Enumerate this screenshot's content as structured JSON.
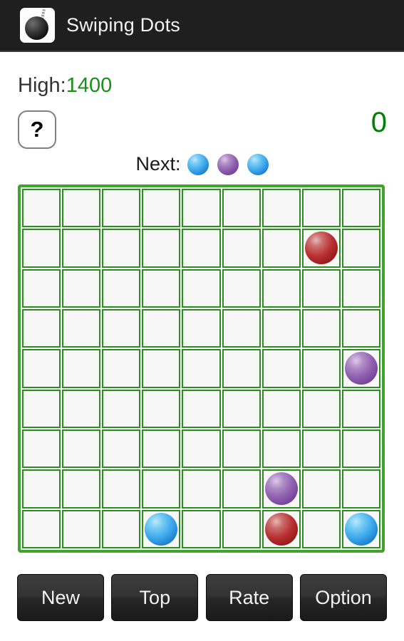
{
  "titlebar": {
    "app_name": "Swiping Dots",
    "icon": "wrecking-ball-icon"
  },
  "stats": {
    "high_label": "High:",
    "high_value": "1400",
    "score": "0",
    "help_label": "?"
  },
  "next": {
    "label": "Next:",
    "balls": [
      "blue",
      "purple",
      "blue"
    ]
  },
  "board": {
    "rows": 9,
    "cols": 9,
    "balls": [
      {
        "row": 1,
        "col": 7,
        "color": "red"
      },
      {
        "row": 4,
        "col": 8,
        "color": "purple"
      },
      {
        "row": 7,
        "col": 6,
        "color": "purple"
      },
      {
        "row": 8,
        "col": 3,
        "color": "blue"
      },
      {
        "row": 8,
        "col": 6,
        "color": "red"
      },
      {
        "row": 8,
        "col": 8,
        "color": "blue"
      }
    ]
  },
  "buttons": [
    {
      "label": "New",
      "name": "new-game-button"
    },
    {
      "label": "Top",
      "name": "top-scores-button"
    },
    {
      "label": "Rate",
      "name": "rate-button"
    },
    {
      "label": "Option",
      "name": "option-button"
    }
  ],
  "colors": {
    "board_border": "#3ea52b",
    "cell_border": "#2e8b22",
    "score_green": "#008000",
    "high_green": "#1a8f1a",
    "titlebar_bg": "#1f1f1f",
    "button_bg": "#262626",
    "ball_blue": "#3fa9ec",
    "ball_purple": "#8e5fae",
    "ball_red": "#b93030"
  }
}
